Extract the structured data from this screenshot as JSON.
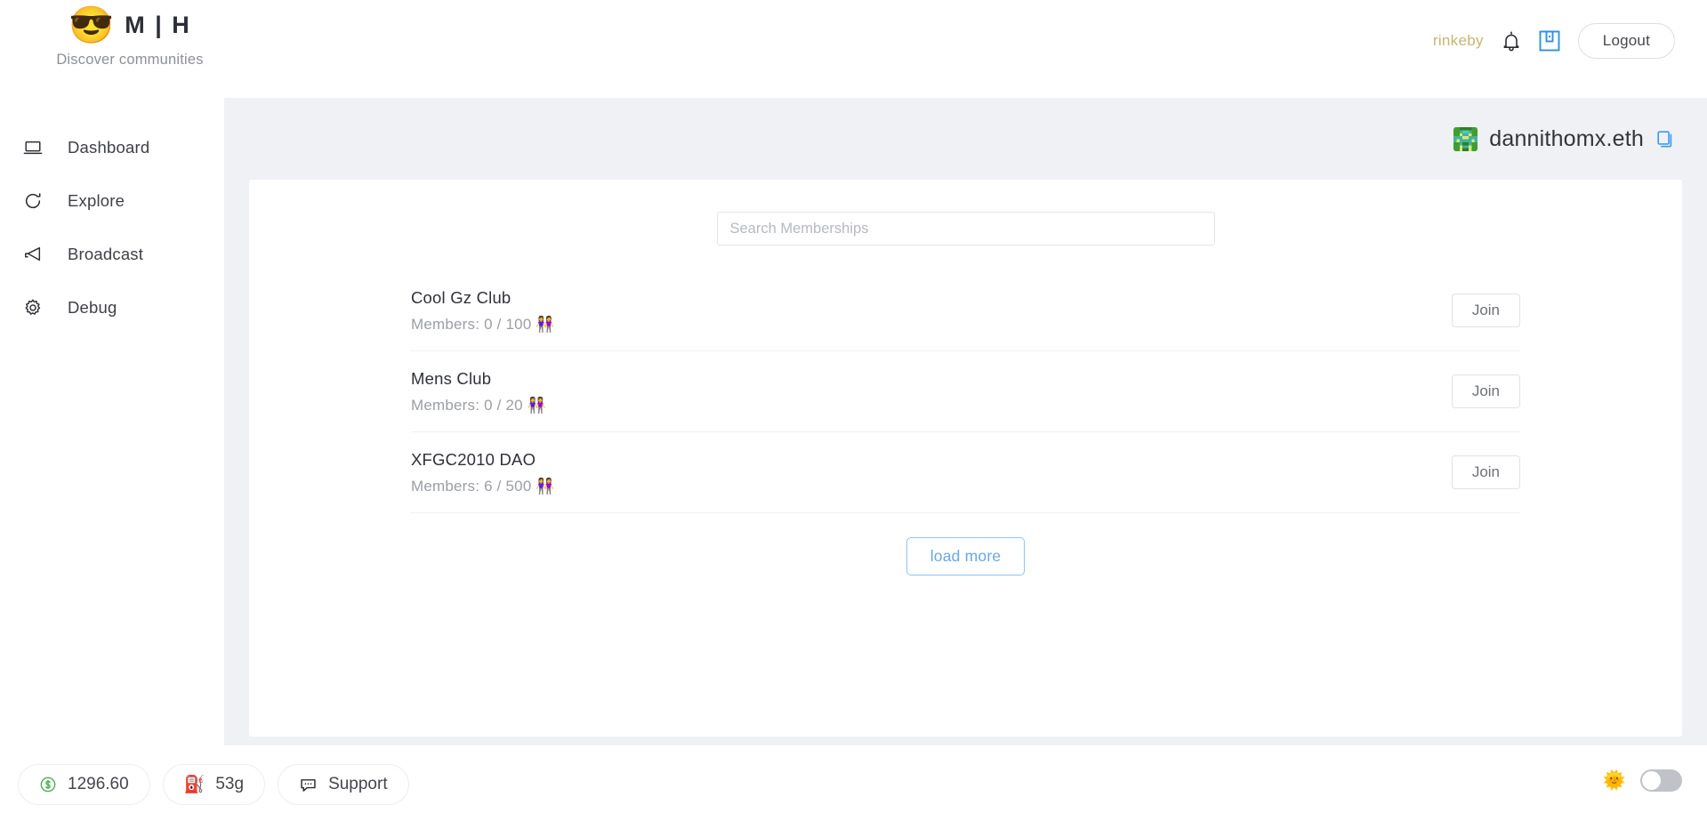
{
  "brand": {
    "emoji": "😎",
    "name": "M | H",
    "tagline": "Discover communities"
  },
  "header": {
    "network": "rinkeby",
    "bell_icon": "bell-icon",
    "save_icon": "save-icon",
    "logout_label": "Logout"
  },
  "sidebar": {
    "items": [
      {
        "label": "Dashboard",
        "icon": "laptop-icon"
      },
      {
        "label": "Explore",
        "icon": "refresh-icon"
      },
      {
        "label": "Broadcast",
        "icon": "megaphone-icon"
      },
      {
        "label": "Debug",
        "icon": "gear-icon"
      }
    ]
  },
  "account": {
    "name": "dannithomx.eth",
    "avatar_icon": "identicon-avatar",
    "copy_icon": "copy-icon"
  },
  "search": {
    "placeholder": "Search Memberships",
    "value": ""
  },
  "memberships": {
    "items": [
      {
        "title": "Cool Gz Club",
        "members": "Members: 0 / 100 👭",
        "action": "Join"
      },
      {
        "title": "Mens Club",
        "members": "Members: 0 / 20 👭",
        "action": "Join"
      },
      {
        "title": "XFGC2010 DAO",
        "members": "Members: 6 / 500 👭",
        "action": "Join"
      }
    ],
    "load_more_label": "load more"
  },
  "footer": {
    "price": {
      "icon": "dollar-circle-icon",
      "value": "1296.60"
    },
    "gas": {
      "icon": "⛽",
      "value": "53g"
    },
    "support": {
      "icon": "chat-bubble-icon",
      "label": "Support"
    },
    "theme": {
      "icon": "🌞",
      "state": "off"
    }
  },
  "colors": {
    "network_accent": "#c9b471",
    "link_blue": "#6aa7e0",
    "icon_blue": "#2f8fe8",
    "page_bg": "#eff1f5",
    "green": "#4caf50"
  }
}
